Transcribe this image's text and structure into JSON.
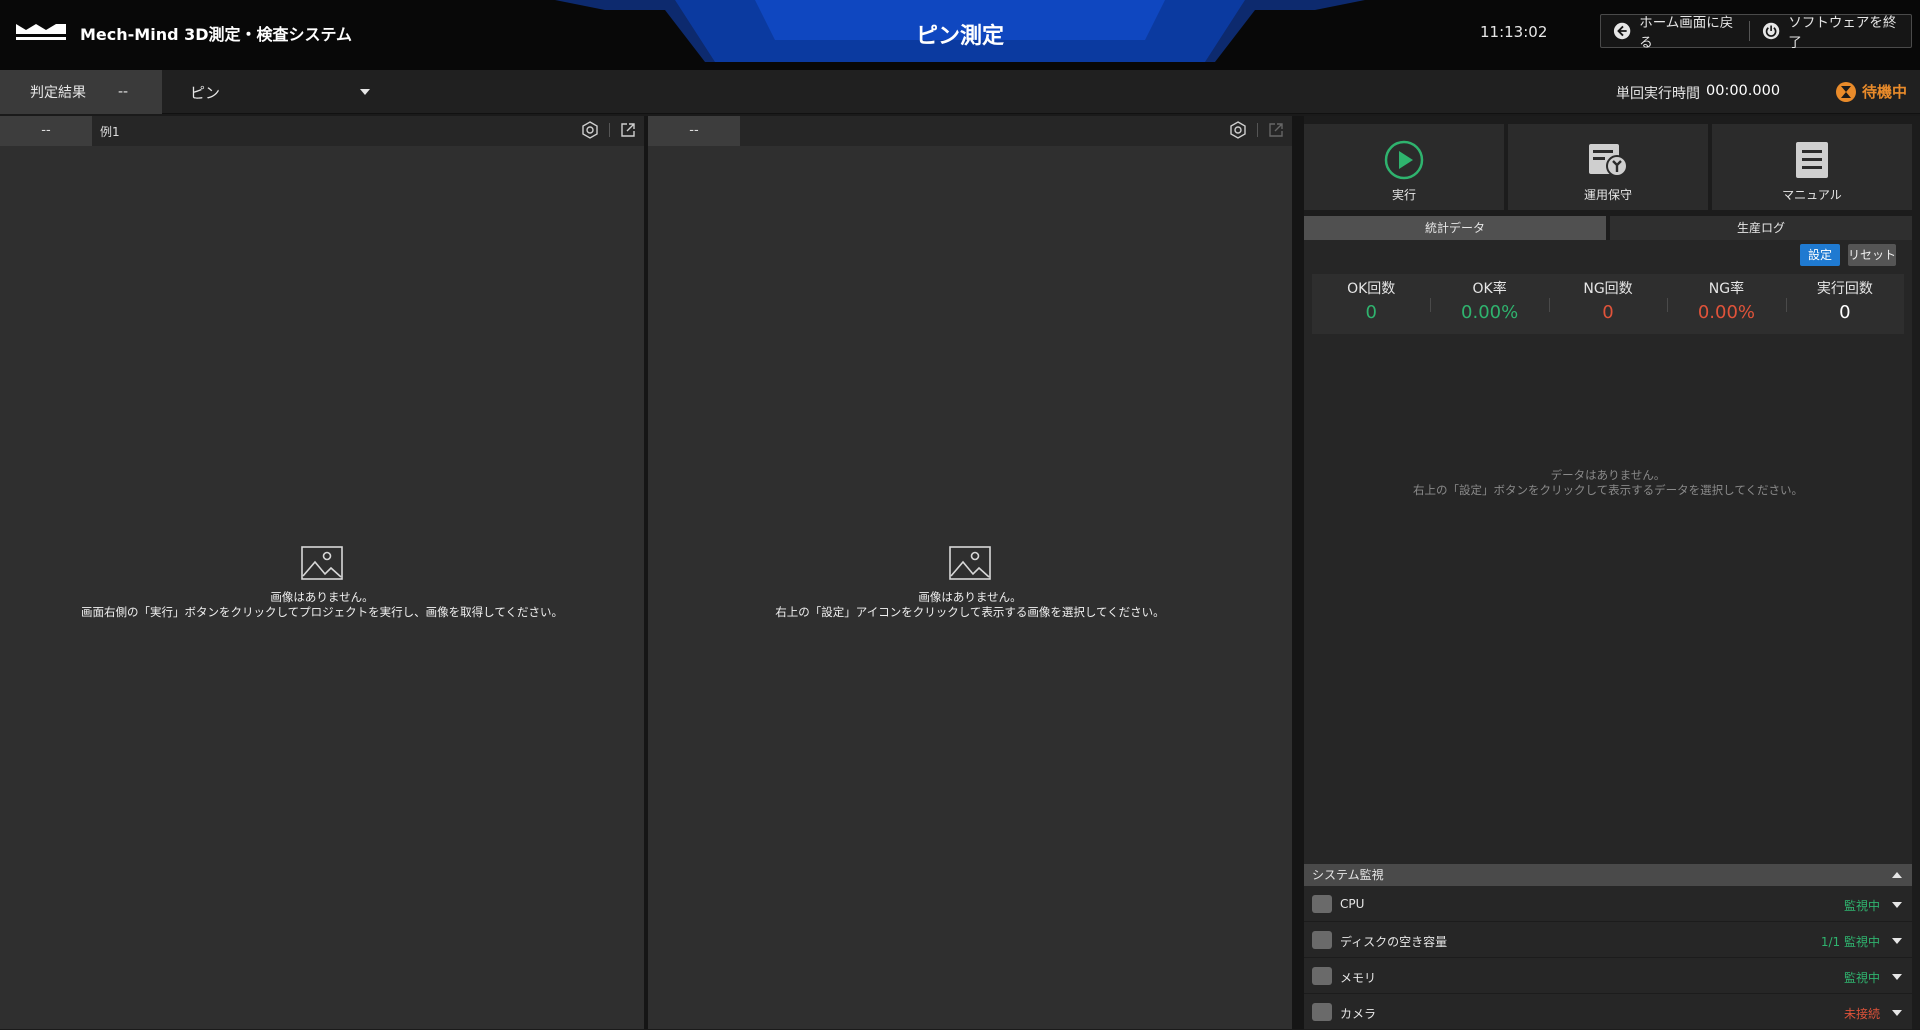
{
  "header": {
    "app_name": "Mech-Mind 3D測定・検査システム",
    "logo_text": "MECH MIND",
    "title": "ピン測定",
    "clock": "11:13:02",
    "home_label": "ホーム画面に戻る",
    "exit_label": "ソフトウェアを終了"
  },
  "toolbar": {
    "judge_label": "判定結果",
    "judge_value": "--",
    "project": "ピン",
    "exec_time_label": "単回実行時間",
    "exec_time_value": "00:00.000",
    "status": "待機中"
  },
  "viewers": [
    {
      "tab": "--",
      "name": "例1",
      "empty_title": "画像はありません。",
      "empty_msg": "画面右側の「実行」ボタンをクリックしてプロジェクトを実行し、画像を取得してください。"
    },
    {
      "tab": "--",
      "name": "",
      "empty_title": "画像はありません。",
      "empty_msg": "右上の「設定」アイコンをクリックして表示する画像を選択してください。"
    }
  ],
  "sidebar": {
    "actions": [
      {
        "label": "実行",
        "icon": "play-icon"
      },
      {
        "label": "運用保守",
        "icon": "maintenance-icon"
      },
      {
        "label": "マニュアル",
        "icon": "manual-icon"
      }
    ],
    "tabs": [
      "統計データ",
      "生産ログ"
    ],
    "set_label": "設定",
    "reset_label": "リセット",
    "metrics": [
      {
        "label": "OK回数",
        "value": "0"
      },
      {
        "label": "OK率",
        "value": "0.00%"
      },
      {
        "label": "NG回数",
        "value": "0"
      },
      {
        "label": "NG率",
        "value": "0.00%"
      },
      {
        "label": "実行回数",
        "value": "0"
      }
    ],
    "no_data_title": "データはありません。",
    "no_data_msg": "右上の「設定」ボタンをクリックして表示するデータを選択してください。",
    "sysmon_title": "システム監視",
    "sysmon_rows": [
      {
        "name": "CPU",
        "status": "監視中",
        "icon": "cpu-icon"
      },
      {
        "name": "ディスクの空き容量",
        "status": "1/1 監視中",
        "icon": "disk-icon"
      },
      {
        "name": "メモリ",
        "status": "監視中",
        "icon": "memory-icon"
      },
      {
        "name": "カメラ",
        "status": "未接続",
        "icon": "camera-icon"
      }
    ]
  },
  "colors": {
    "ok_green": "#2fb36e",
    "ng_red": "#e0533a",
    "accent_blue": "#1f7ad1",
    "status_orange": "#e98b2a",
    "header_band": "#0b3aa0"
  }
}
